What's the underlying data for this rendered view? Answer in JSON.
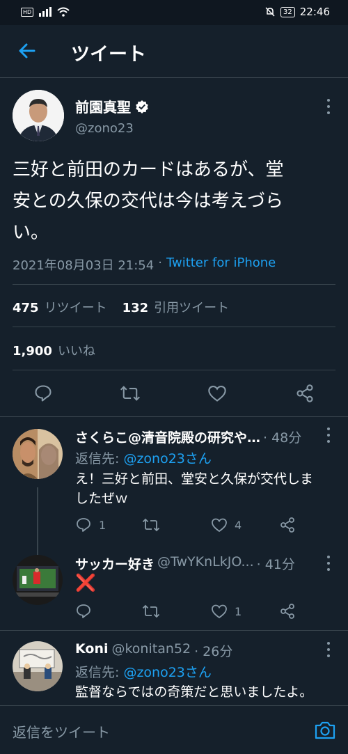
{
  "status_bar": {
    "network": "HD",
    "battery": "32",
    "time": "22:46"
  },
  "header": {
    "title": "ツイート"
  },
  "tweet": {
    "author_name": "前園真聖",
    "handle": "@zono23",
    "text_lines": [
      "三好と前田のカードはあるが、堂",
      "安との久保の交代は今は考えづら",
      "い。"
    ],
    "timestamp": "2021年08月03日 21:54",
    "separator": "·",
    "source": "Twitter for iPhone",
    "retweets_count": "475",
    "retweets_label": "リツイート",
    "quotes_count": "132",
    "quotes_label": "引用ツイート",
    "likes_count": "1,900",
    "likes_label": "いいね"
  },
  "replies": [
    {
      "name": "さくらこ@清音院殿の研究や…",
      "handle": "",
      "time": "· 48分",
      "reply_prefix": "返信先: ",
      "reply_to": "@zono23さん",
      "text_lines": [
        "え！三好と前田、堂安と久保が交代しま",
        "したぜｗ"
      ],
      "reply_count": "1",
      "retweet_count": "",
      "like_count": "4"
    },
    {
      "name": "サッカー好き",
      "handle": "@TwYKnLkJO...",
      "time": "· 41分",
      "reply_prefix": "",
      "reply_to": "",
      "text_lines": [
        "❌"
      ],
      "reply_count": "",
      "retweet_count": "",
      "like_count": "1"
    },
    {
      "name": "Koni",
      "handle": "@konitan52",
      "time": "· 26分",
      "reply_prefix": "返信先: ",
      "reply_to": "@zono23さん",
      "text_lines": [
        "監督ならではの奇策だと思いましたよ。"
      ],
      "reply_count": "",
      "retweet_count": "",
      "like_count": ""
    }
  ],
  "compose": {
    "placeholder": "返信をツイート"
  },
  "colors": {
    "background": "#15202b",
    "accent": "#1da1f2",
    "secondary_text": "#8899a6",
    "divider": "#38444d",
    "cross": "#e0245e"
  },
  "icons": [
    "back-arrow-icon",
    "verified-badge-icon",
    "more-icon",
    "reply-icon",
    "retweet-icon",
    "like-icon",
    "share-icon",
    "camera-icon"
  ]
}
